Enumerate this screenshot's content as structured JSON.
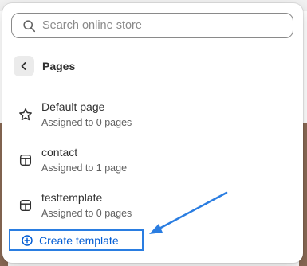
{
  "search": {
    "placeholder": "Search online store",
    "icon": "search-icon"
  },
  "header": {
    "title": "Pages",
    "back_icon": "chevron-left-icon"
  },
  "items": [
    {
      "title": "Default page",
      "subtitle": "Assigned to 0 pages",
      "icon": "star-icon"
    },
    {
      "title": "contact",
      "subtitle": "Assigned to 1 page",
      "icon": "layout-icon"
    },
    {
      "title": "testtemplate",
      "subtitle": "Assigned to 0 pages",
      "icon": "layout-icon"
    }
  ],
  "create": {
    "label": "Create template",
    "icon": "plus-circle-icon"
  },
  "colors": {
    "accent": "#005bd3",
    "annotation": "#2a7de1",
    "text": "#303030",
    "subtext": "#616161"
  }
}
